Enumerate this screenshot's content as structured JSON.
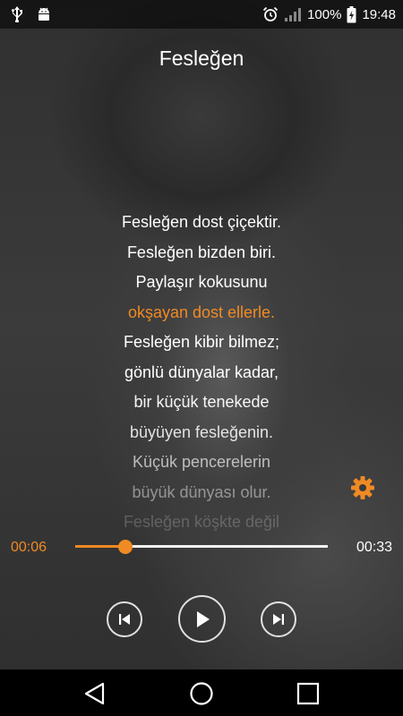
{
  "status_bar": {
    "icons_left": [
      "usb-icon",
      "android-debug-icon"
    ],
    "icons_right": [
      "alarm-icon",
      "signal-icon",
      "battery-charging-icon"
    ],
    "battery": "100%",
    "time": "19:48"
  },
  "song": {
    "title": "Fesleğen"
  },
  "lyrics": [
    {
      "text": "Fesleğen dost çiçektir.",
      "color": "#ffffff",
      "opacity": 1
    },
    {
      "text": "Fesleğen bizden biri.",
      "color": "#ffffff",
      "opacity": 1
    },
    {
      "text": "Paylaşır kokusunu",
      "color": "#ffffff",
      "opacity": 1
    },
    {
      "text": "okşayan dost ellerle.",
      "color": "#f08a24",
      "opacity": 1
    },
    {
      "text": "Fesleğen kibir bilmez;",
      "color": "#ffffff",
      "opacity": 1
    },
    {
      "text": "gönlü dünyalar kadar,",
      "color": "#ffffff",
      "opacity": 1
    },
    {
      "text": "bir küçük tenekede",
      "color": "#ffffff",
      "opacity": 0.95
    },
    {
      "text": "büyüyen fesleğenin.",
      "color": "#ffffff",
      "opacity": 0.85
    },
    {
      "text": "Küçük pencerelerin",
      "color": "#ffffff",
      "opacity": 0.65
    },
    {
      "text": "büyük dünyası olur.",
      "color": "#ffffff",
      "opacity": 0.45
    },
    {
      "text": "Fesleğen köşkte değil",
      "color": "#ffffff",
      "opacity": 0.2
    }
  ],
  "player": {
    "current_time": "00:06",
    "total_time": "00:33",
    "progress_fraction": 0.2,
    "accent_color": "#f08a24"
  }
}
